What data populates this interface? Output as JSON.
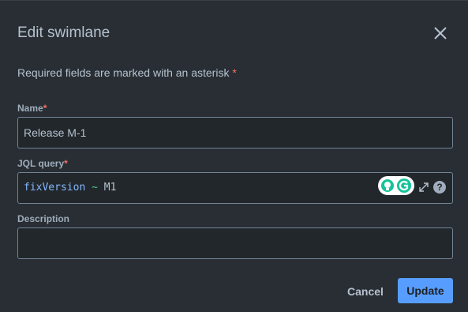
{
  "dialog": {
    "title": "Edit swimlane",
    "required_note": "Required fields are marked with an asterisk",
    "asterisk": "*"
  },
  "fields": {
    "name": {
      "label": "Name",
      "value": "Release M-1"
    },
    "jql": {
      "label": "JQL query",
      "tokens": {
        "field": "fixVersion",
        "operator": "~",
        "value": "M1"
      }
    },
    "description": {
      "label": "Description",
      "value": ""
    }
  },
  "icons": {
    "close": "close-icon",
    "expand": "expand-icon",
    "help": "help-icon",
    "help_glyph": "?"
  },
  "buttons": {
    "cancel": "Cancel",
    "update": "Update"
  },
  "colors": {
    "background": "#282e33",
    "field_background": "#22272b",
    "border": "#738496",
    "primary": "#579dff",
    "asterisk": "#f87168",
    "jql_field": "#85b8ff",
    "jql_operator": "#4bce97"
  }
}
